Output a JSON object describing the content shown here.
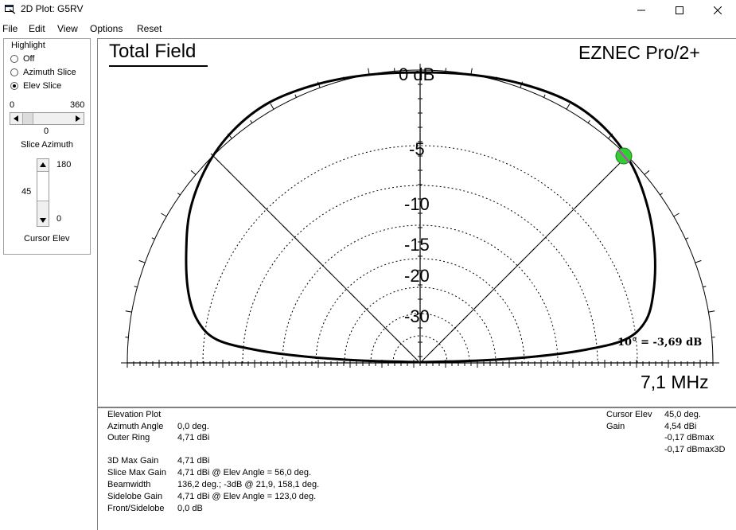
{
  "window": {
    "title": "2D Plot: G5RV",
    "minimize_icon": "minimize-icon",
    "maximize_icon": "maximize-icon",
    "close_icon": "close-icon"
  },
  "menu": [
    "File",
    "Edit",
    "View",
    "Options",
    "Reset"
  ],
  "highlight": {
    "legend": "Highlight",
    "options": [
      {
        "label": "Off",
        "selected": false
      },
      {
        "label": "Azimuth Slice",
        "selected": false
      },
      {
        "label": "Elev Slice",
        "selected": true
      }
    ]
  },
  "slice_azimuth": {
    "min": "0",
    "max": "360",
    "value": "0",
    "label": "Slice Azimuth"
  },
  "cursor_elev": {
    "top": "180",
    "bottom": "0",
    "value": "45",
    "label": "Cursor Elev"
  },
  "plot": {
    "title": "Total Field",
    "brand": "EZNEC Pro/2+",
    "frequency": "7,1 MHz",
    "readout": "10° = -3,69 dB",
    "ring_labels": [
      "0 dB",
      "-5",
      "-10",
      "-15",
      "-20",
      "-30"
    ],
    "colors": {
      "pattern": "#000000",
      "cursor_fill": "#33cc33",
      "cursor_line": "#cc33cc"
    }
  },
  "chart_data": {
    "type": "polar-elevation",
    "rings_db": [
      0,
      -5,
      -10,
      -15,
      -20,
      -30
    ],
    "cursor_elev_deg": 45,
    "cursor_level_dbmax": -0.17,
    "max_gain_dbi": 4.71,
    "max_elev_deg": 56.0,
    "beamwidth_3db_deg": [
      21.9,
      158.1
    ]
  },
  "info_left": [
    {
      "label": "Elevation Plot",
      "value": ""
    },
    {
      "label": "Azimuth Angle",
      "value": "0,0 deg."
    },
    {
      "label": "Outer Ring",
      "value": "4,71 dBi"
    },
    {
      "label": "3D Max Gain",
      "value": "4,71 dBi"
    },
    {
      "label": "Slice Max Gain",
      "value": "4,71 dBi @ Elev Angle = 56,0 deg."
    },
    {
      "label": "Beamwidth",
      "value": "136,2 deg.; -3dB @ 21,9, 158,1 deg."
    },
    {
      "label": "Sidelobe Gain",
      "value": "4,71 dBi @ Elev Angle = 123,0 deg."
    },
    {
      "label": "Front/Sidelobe",
      "value": "0,0 dB"
    }
  ],
  "info_right": {
    "cursor_elev_label": "Cursor Elev",
    "cursor_elev_value": "45,0 deg.",
    "gain_label": "Gain",
    "gain_value": "4,54 dBi",
    "dbmax": "-0,17 dBmax",
    "dbmax3d": "-0,17 dBmax3D"
  }
}
